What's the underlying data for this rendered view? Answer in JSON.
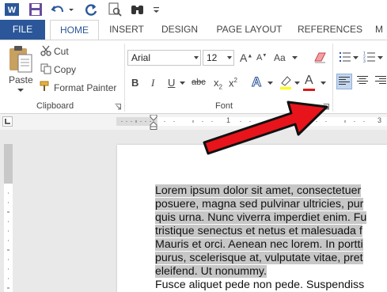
{
  "tabs": {
    "file": "FILE",
    "items": [
      "HOME",
      "INSERT",
      "DESIGN",
      "PAGE LAYOUT",
      "REFERENCES",
      "M"
    ]
  },
  "clipboard": {
    "paste": "Paste",
    "cut": "Cut",
    "copy": "Copy",
    "format_painter": "Format Painter",
    "group_label": "Clipboard"
  },
  "font": {
    "name": "Arial",
    "size": "12",
    "group_label": "Font",
    "bold": "B",
    "italic": "I",
    "underline": "U",
    "strike": "abc",
    "subscript": "x",
    "superscript": "x",
    "sub_mark": "2",
    "sup_mark": "2",
    "grow": "A",
    "shrink": "A",
    "case": "Aa",
    "color_letter": "A",
    "effects_letter": "A"
  },
  "ruler": {
    "marks": [
      "1",
      "2",
      "3"
    ]
  },
  "document": {
    "lines": [
      {
        "text": "Lorem ipsum dolor sit amet, consectetuer",
        "selected": true
      },
      {
        "text": "posuere, magna sed pulvinar ultricies, pur",
        "selected": true
      },
      {
        "text": "quis urna. Nunc viverra imperdiet enim. Fu",
        "selected": true
      },
      {
        "text": "tristique senectus et netus et malesuada f",
        "selected": true
      },
      {
        "text": "Mauris et orci. Aenean nec lorem. In portti",
        "selected": true
      },
      {
        "text": "purus, scelerisque at, vulputate vitae, pret",
        "selected": true
      },
      {
        "text": "eleifend. Ut nonummy.",
        "selected": true
      },
      {
        "text": "Fusce aliquet pede non pede. Suspendiss",
        "selected": false
      }
    ]
  },
  "colors": {
    "accent": "#2b579a",
    "arrow": "#e8141b",
    "font_color": "#d71b1b",
    "selection": "#c7c7c7"
  }
}
